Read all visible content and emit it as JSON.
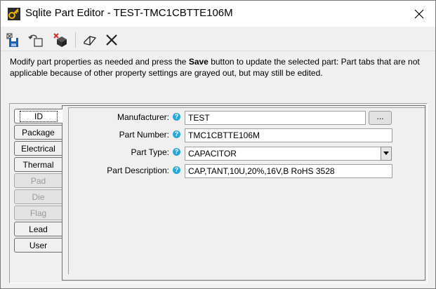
{
  "window": {
    "title": "Sqlite Part Editor - TEST-TMC1CBTTE106M"
  },
  "toolbar": {
    "icons": [
      "save-icon",
      "undo-icon",
      "delete-part-icon",
      "eraser-icon",
      "close-icon"
    ]
  },
  "description": {
    "before": "Modify part properties as needed and press the ",
    "bold": "Save",
    "after": " button to update the selected part: Part tabs that are not applicable because of other property settings are grayed out, but may still be edited."
  },
  "tabs": [
    {
      "label": "ID",
      "state": "selected"
    },
    {
      "label": "Package",
      "state": "enabled"
    },
    {
      "label": "Electrical",
      "state": "enabled"
    },
    {
      "label": "Thermal",
      "state": "enabled"
    },
    {
      "label": "Pad",
      "state": "disabled"
    },
    {
      "label": "Die",
      "state": "disabled"
    },
    {
      "label": "Flag",
      "state": "disabled"
    },
    {
      "label": "Lead",
      "state": "enabled"
    },
    {
      "label": "User",
      "state": "enabled"
    }
  ],
  "fields": {
    "manufacturer": {
      "label": "Manufacturer:",
      "value": "TEST"
    },
    "part_number": {
      "label": "Part Number:",
      "value": "TMC1CBTTE106M"
    },
    "part_type": {
      "label": "Part Type:",
      "value": "CAPACITOR"
    },
    "part_description": {
      "label": "Part Description:",
      "value": "CAP,TANT,10U,20%,16V,B RoHS 3528"
    }
  },
  "help_glyph": "?",
  "browse_label": "...",
  "colors": {
    "help_icon": "#28a8d8",
    "save_icon_blue": "#1a5fb4",
    "delete_icon_red": "#d32f2f"
  }
}
